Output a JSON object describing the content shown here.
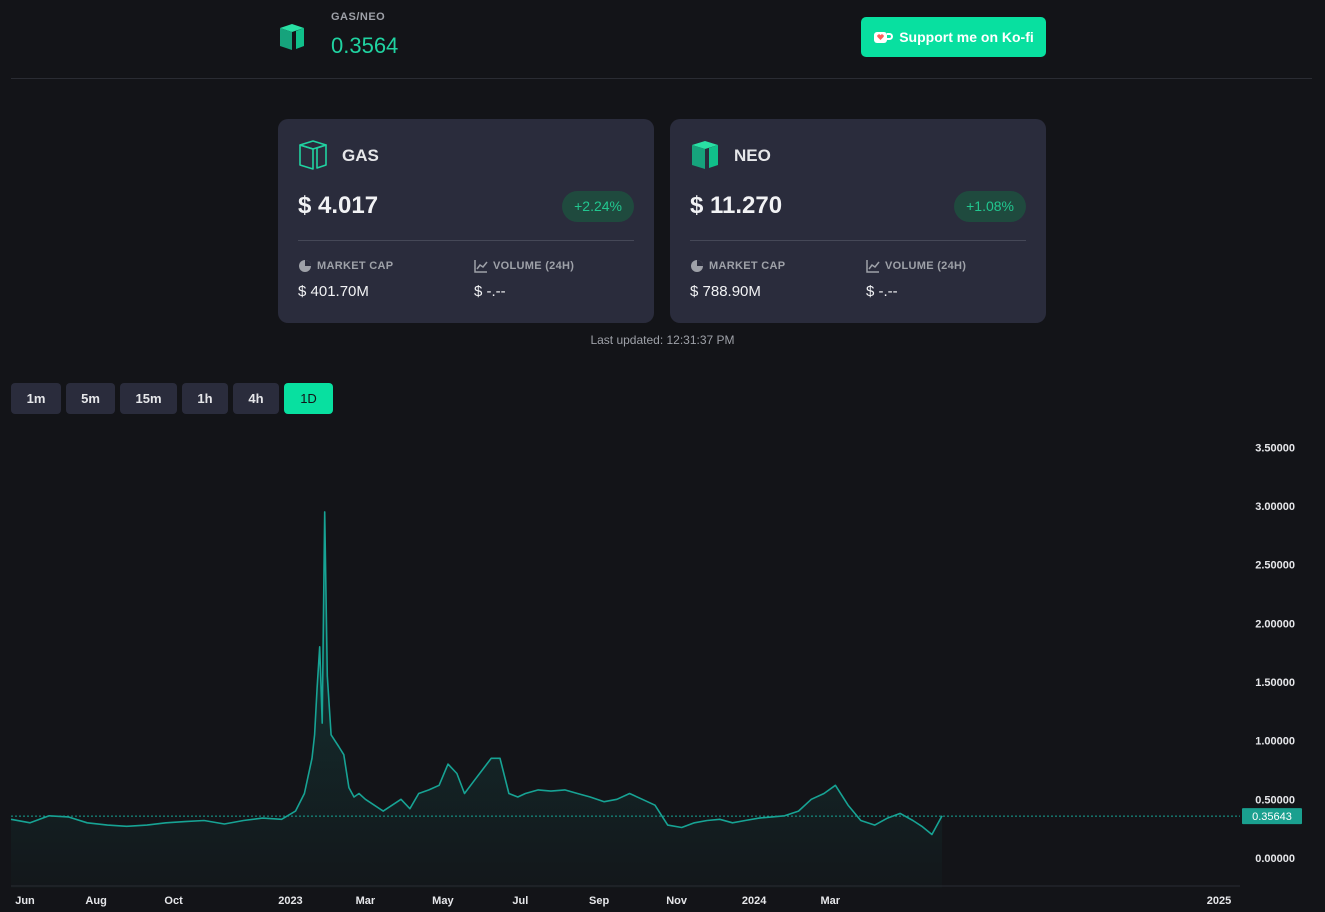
{
  "header": {
    "pair_label": "GAS/NEO",
    "pair_value": "0.3564",
    "logo_icon": "neo-logo-icon",
    "kofi_label": "Support me on Ko-fi",
    "kofi_icon": "coffee-cup-icon"
  },
  "cards": {
    "gas": {
      "symbol": "GAS",
      "price": "$ 4.017",
      "change": "+2.24%",
      "market_cap_label": "MARKET CAP",
      "market_cap_value": "$ 401.70M",
      "volume_label": "VOLUME (24H)",
      "volume_value": "$ -.--"
    },
    "neo": {
      "symbol": "NEO",
      "price": "$ 11.270",
      "change": "+1.08%",
      "market_cap_label": "MARKET CAP",
      "market_cap_value": "$ 788.90M",
      "volume_label": "VOLUME (24H)",
      "volume_value": "$ -.--"
    }
  },
  "last_updated": "Last updated: 12:31:37 PM",
  "timeframes": [
    {
      "label": "1m",
      "active": false
    },
    {
      "label": "5m",
      "active": false
    },
    {
      "label": "15m",
      "active": false
    },
    {
      "label": "1h",
      "active": false
    },
    {
      "label": "4h",
      "active": false
    },
    {
      "label": "1D",
      "active": true
    }
  ],
  "colors": {
    "accent": "#08e0a0",
    "line": "#17a394",
    "positive": "#22c68f",
    "card_bg": "#2a2c3c",
    "page_bg": "#131418"
  },
  "chart_data": {
    "type": "area",
    "title": "",
    "xlabel": "",
    "ylabel": "",
    "ylim": [
      -0.15,
      3.5
    ],
    "y_ticks": [
      "3.50000",
      "3.00000",
      "2.50000",
      "2.00000",
      "1.50000",
      "1.00000",
      "0.50000",
      "0.00000"
    ],
    "x_ticks": [
      "Jun",
      "Aug",
      "Oct",
      "2023",
      "Mar",
      "May",
      "Jul",
      "Sep",
      "Nov",
      "2024",
      "Mar",
      "2025"
    ],
    "x_tick_dates": [
      "2022-06-01",
      "2022-08-01",
      "2022-10-01",
      "2023-01-01",
      "2023-03-01",
      "2023-05-01",
      "2023-07-01",
      "2023-09-01",
      "2023-11-01",
      "2024-01-01",
      "2024-03-01",
      "2025-01-01"
    ],
    "current_value_label": "0.35643",
    "current_value": 0.35643,
    "grid": false,
    "series": [
      {
        "x": [
          "2022-05-26",
          "2022-06-10",
          "2022-06-25",
          "2022-07-10",
          "2022-07-25",
          "2022-08-10",
          "2022-08-25",
          "2022-09-10",
          "2022-09-25",
          "2022-10-10",
          "2022-10-25",
          "2022-11-10",
          "2022-11-25",
          "2022-12-10",
          "2022-12-25",
          "2023-01-05",
          "2023-01-12",
          "2023-01-18",
          "2023-01-20",
          "2023-01-22",
          "2023-01-24",
          "2023-01-26",
          "2023-01-28",
          "2023-01-30",
          "2023-02-02",
          "2023-02-05",
          "2023-02-08",
          "2023-02-12",
          "2023-02-16",
          "2023-02-20",
          "2023-02-24",
          "2023-03-01",
          "2023-03-08",
          "2023-03-15",
          "2023-03-22",
          "2023-03-29",
          "2023-04-05",
          "2023-04-12",
          "2023-04-20",
          "2023-04-28",
          "2023-05-05",
          "2023-05-12",
          "2023-05-18",
          "2023-05-25",
          "2023-06-01",
          "2023-06-08",
          "2023-06-15",
          "2023-06-22",
          "2023-06-29",
          "2023-07-05",
          "2023-07-15",
          "2023-07-25",
          "2023-08-05",
          "2023-08-15",
          "2023-08-25",
          "2023-09-05",
          "2023-09-15",
          "2023-09-25",
          "2023-10-05",
          "2023-10-15",
          "2023-10-25",
          "2023-11-05",
          "2023-11-15",
          "2023-11-25",
          "2023-12-05",
          "2023-12-15",
          "2023-12-25",
          "2024-01-05",
          "2024-01-15",
          "2024-01-25",
          "2024-02-05",
          "2024-02-15",
          "2024-02-25",
          "2024-03-05",
          "2024-03-15",
          "2024-03-25",
          "2024-04-05",
          "2024-04-15",
          "2024-04-25",
          "2024-05-05",
          "2024-05-12",
          "2024-05-20",
          "2024-05-28"
        ],
        "y": [
          0.33,
          0.3,
          0.36,
          0.35,
          0.3,
          0.28,
          0.27,
          0.28,
          0.3,
          0.31,
          0.32,
          0.29,
          0.32,
          0.34,
          0.33,
          0.4,
          0.55,
          0.85,
          1.05,
          1.45,
          1.8,
          1.15,
          2.95,
          1.55,
          1.05,
          1.0,
          0.95,
          0.88,
          0.6,
          0.52,
          0.55,
          0.5,
          0.45,
          0.4,
          0.45,
          0.5,
          0.42,
          0.55,
          0.58,
          0.62,
          0.8,
          0.72,
          0.55,
          0.65,
          0.75,
          0.85,
          0.85,
          0.55,
          0.52,
          0.55,
          0.58,
          0.57,
          0.58,
          0.55,
          0.52,
          0.48,
          0.5,
          0.55,
          0.5,
          0.45,
          0.28,
          0.26,
          0.3,
          0.32,
          0.33,
          0.3,
          0.32,
          0.34,
          0.35,
          0.36,
          0.4,
          0.5,
          0.55,
          0.62,
          0.45,
          0.32,
          0.28,
          0.34,
          0.38,
          0.32,
          0.27,
          0.2,
          0.36
        ]
      }
    ]
  }
}
